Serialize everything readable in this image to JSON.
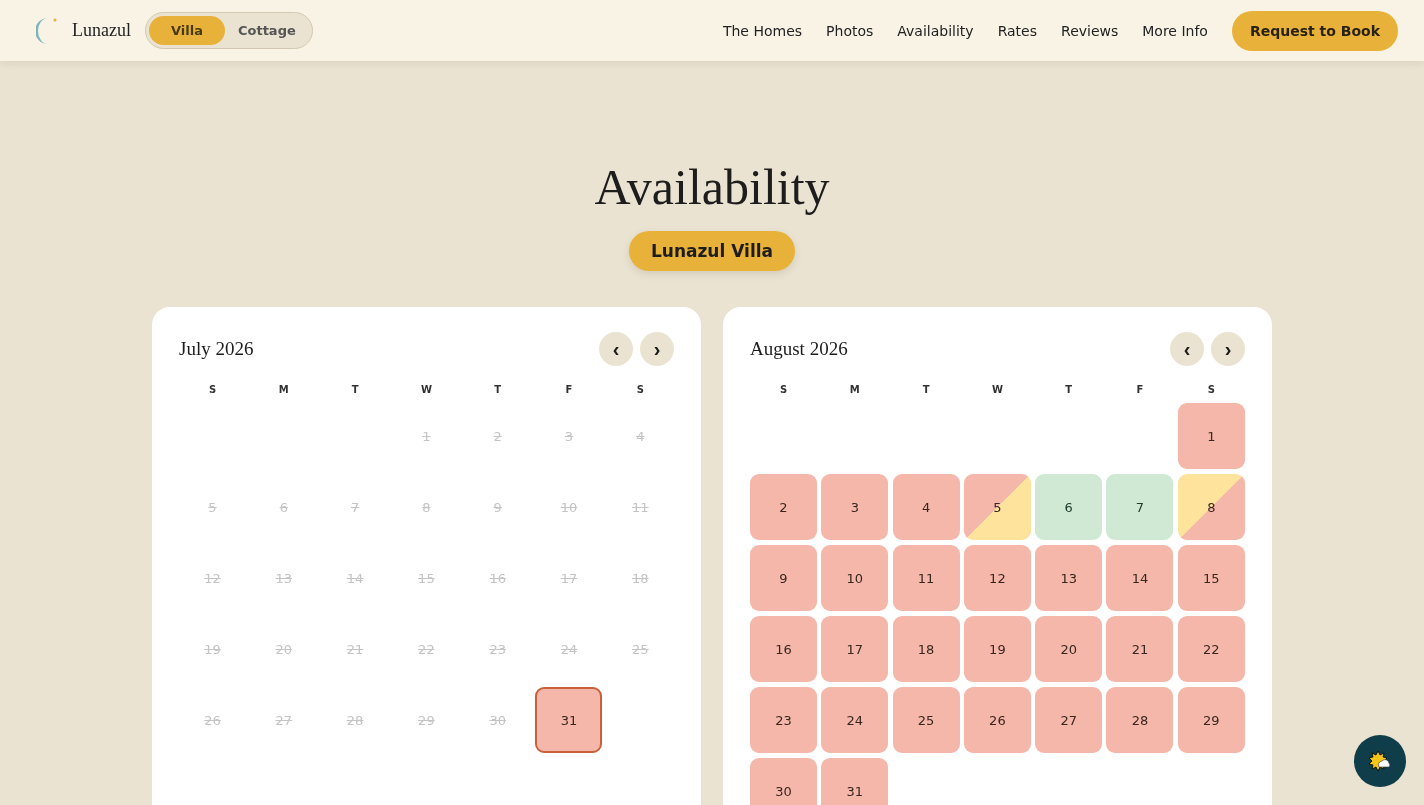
{
  "brand": {
    "name": "Lunazul"
  },
  "home_toggle": [
    {
      "label": "Villa",
      "selected": true
    },
    {
      "label": "Cottage",
      "selected": false
    }
  ],
  "nav": [
    "The Homes",
    "Photos",
    "Availability",
    "Rates",
    "Reviews",
    "More Info"
  ],
  "cta": "Request to Book",
  "heading": "Availability",
  "home_badge": "Lunazul Villa",
  "calendars": [
    {
      "title": "July 2026",
      "prev": "‹",
      "next": "›",
      "weekdays": [
        "S",
        "M",
        "T",
        "W",
        "T",
        "F",
        "S"
      ],
      "days": [
        {
          "kind": "blank"
        },
        {
          "kind": "blank"
        },
        {
          "kind": "blank"
        },
        {
          "day": "1",
          "kind": "past",
          "today": false
        },
        {
          "day": "2",
          "kind": "past",
          "today": false
        },
        {
          "day": "3",
          "kind": "past",
          "today": false
        },
        {
          "day": "4",
          "kind": "past",
          "today": false
        },
        {
          "day": "5",
          "kind": "past",
          "today": false
        },
        {
          "day": "6",
          "kind": "past",
          "today": false
        },
        {
          "day": "7",
          "kind": "past",
          "today": false
        },
        {
          "day": "8",
          "kind": "past",
          "today": false
        },
        {
          "day": "9",
          "kind": "past",
          "today": false
        },
        {
          "day": "10",
          "kind": "past",
          "today": false
        },
        {
          "day": "11",
          "kind": "past",
          "today": false
        },
        {
          "day": "12",
          "kind": "past",
          "today": false
        },
        {
          "day": "13",
          "kind": "past",
          "today": false
        },
        {
          "day": "14",
          "kind": "past",
          "today": false
        },
        {
          "day": "15",
          "kind": "past",
          "today": false
        },
        {
          "day": "16",
          "kind": "past",
          "today": false
        },
        {
          "day": "17",
          "kind": "past",
          "today": false
        },
        {
          "day": "18",
          "kind": "past",
          "today": false
        },
        {
          "day": "19",
          "kind": "past",
          "today": false
        },
        {
          "day": "20",
          "kind": "past",
          "today": false
        },
        {
          "day": "21",
          "kind": "past",
          "today": false
        },
        {
          "day": "22",
          "kind": "past",
          "today": false
        },
        {
          "day": "23",
          "kind": "past",
          "today": false
        },
        {
          "day": "24",
          "kind": "past",
          "today": false
        },
        {
          "day": "25",
          "kind": "past",
          "today": false
        },
        {
          "day": "26",
          "kind": "past",
          "today": false
        },
        {
          "day": "27",
          "kind": "past",
          "today": false
        },
        {
          "day": "28",
          "kind": "past",
          "today": false
        },
        {
          "day": "29",
          "kind": "past",
          "today": false
        },
        {
          "day": "30",
          "kind": "past",
          "today": false
        },
        {
          "day": "31",
          "kind": "booked",
          "today": true
        }
      ]
    },
    {
      "title": "August 2026",
      "prev": "‹",
      "next": "›",
      "weekdays": [
        "S",
        "M",
        "T",
        "W",
        "T",
        "F",
        "S"
      ],
      "days": [
        {
          "kind": "blank"
        },
        {
          "kind": "blank"
        },
        {
          "kind": "blank"
        },
        {
          "kind": "blank"
        },
        {
          "kind": "blank"
        },
        {
          "kind": "blank"
        },
        {
          "day": "1",
          "kind": "booked",
          "today": false
        },
        {
          "day": "2",
          "kind": "booked",
          "today": false
        },
        {
          "day": "3",
          "kind": "booked",
          "today": false
        },
        {
          "day": "4",
          "kind": "booked",
          "today": false
        },
        {
          "day": "5",
          "kind": "checkout",
          "today": false
        },
        {
          "day": "6",
          "kind": "available",
          "today": false
        },
        {
          "day": "7",
          "kind": "available",
          "today": false
        },
        {
          "day": "8",
          "kind": "checkin",
          "today": false
        },
        {
          "day": "9",
          "kind": "booked",
          "today": false
        },
        {
          "day": "10",
          "kind": "booked",
          "today": false
        },
        {
          "day": "11",
          "kind": "booked",
          "today": false
        },
        {
          "day": "12",
          "kind": "booked",
          "today": false
        },
        {
          "day": "13",
          "kind": "booked",
          "today": false
        },
        {
          "day": "14",
          "kind": "booked",
          "today": false
        },
        {
          "day": "15",
          "kind": "booked",
          "today": false
        },
        {
          "day": "16",
          "kind": "booked",
          "today": false
        },
        {
          "day": "17",
          "kind": "booked",
          "today": false
        },
        {
          "day": "18",
          "kind": "booked",
          "today": false
        },
        {
          "day": "19",
          "kind": "booked",
          "today": false
        },
        {
          "day": "20",
          "kind": "booked",
          "today": false
        },
        {
          "day": "21",
          "kind": "booked",
          "today": false
        },
        {
          "day": "22",
          "kind": "booked",
          "today": false
        },
        {
          "day": "23",
          "kind": "booked",
          "today": false
        },
        {
          "day": "24",
          "kind": "booked",
          "today": false
        },
        {
          "day": "25",
          "kind": "booked",
          "today": false
        },
        {
          "day": "26",
          "kind": "booked",
          "today": false
        },
        {
          "day": "27",
          "kind": "booked",
          "today": false
        },
        {
          "day": "28",
          "kind": "booked",
          "today": false
        },
        {
          "day": "29",
          "kind": "booked",
          "today": false
        },
        {
          "day": "30",
          "kind": "booked",
          "today": false
        },
        {
          "day": "31",
          "kind": "booked",
          "today": false
        }
      ]
    }
  ]
}
